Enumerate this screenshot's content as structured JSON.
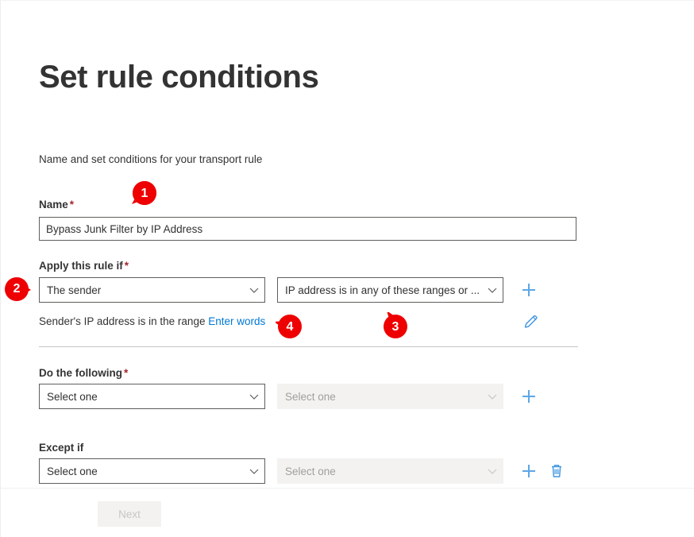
{
  "page": {
    "title": "Set rule conditions",
    "subtitle": "Name and set conditions for your transport rule"
  },
  "name_field": {
    "label": "Name",
    "required_marker": "*",
    "value": "Bypass Junk Filter by IP Address"
  },
  "apply_rule": {
    "label": "Apply this rule if",
    "required_marker": "*",
    "dropdown_primary": "The sender",
    "dropdown_secondary": "IP address is in any of these ranges or ...",
    "add_label": "+",
    "condition_prefix": "Sender's IP address is in the range",
    "condition_link": "Enter words"
  },
  "do_following": {
    "label": "Do the following",
    "required_marker": "*",
    "dropdown_primary": "Select one",
    "dropdown_secondary": "Select one"
  },
  "except_if": {
    "label": "Except if",
    "dropdown_primary": "Select one",
    "dropdown_secondary": "Select one"
  },
  "footer": {
    "next_label": "Next"
  },
  "callouts": [
    {
      "number": "1"
    },
    {
      "number": "2"
    },
    {
      "number": "3"
    },
    {
      "number": "4"
    }
  ],
  "colors": {
    "accent_blue": "#0078d4",
    "icon_blue": "#5ea6e8",
    "callout_red": "#ee0000",
    "required_red": "#a4262c",
    "text": "#333333",
    "border": "#605e5c",
    "disabled_bg": "#f3f2f1",
    "disabled_text": "#a19f9d"
  },
  "icons": {
    "chevron": "chevron-down-icon",
    "pencil": "edit-pencil-icon",
    "plus": "add-plus-icon",
    "trash": "delete-trash-icon"
  }
}
